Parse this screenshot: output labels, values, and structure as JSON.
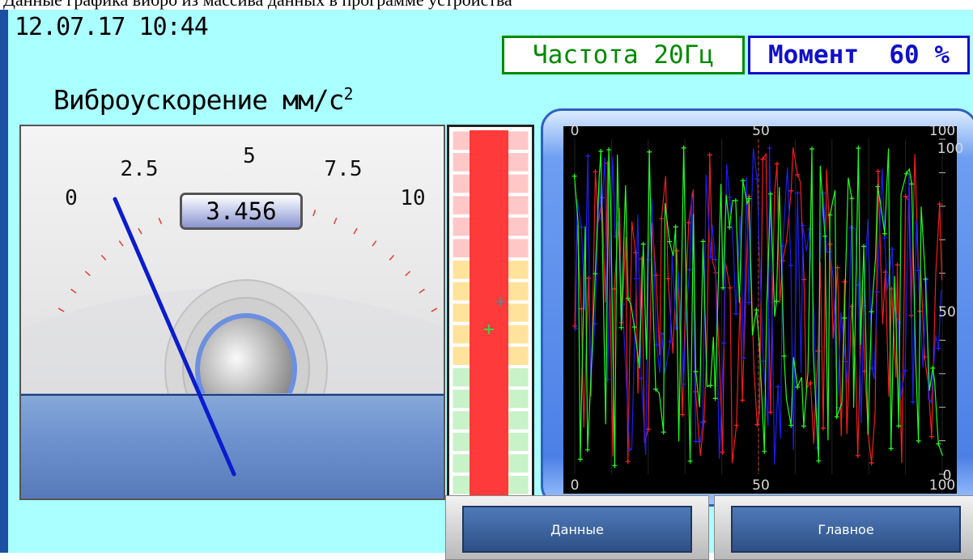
{
  "top_strip": {
    "text": "Данные графика вибро из массива данных в программе устройства"
  },
  "header": {
    "datetime": "12.07.17   10:44",
    "frequency": "Частота 20Гц",
    "moment_label": "Момент",
    "moment_value": "60 %"
  },
  "gauge": {
    "title": "Виброускорение мм/с",
    "title_sup": "2",
    "ticks": [
      "0",
      "2.5",
      "5",
      "7.5",
      "10"
    ],
    "readout": "3.456",
    "value": 3.456,
    "min": 0,
    "max": 10
  },
  "bargraph": {
    "level_percent": 100
  },
  "trend": {
    "x_axis_top": [
      "0",
      "50",
      "100"
    ],
    "x_axis_bottom": [
      "0",
      "50",
      "100"
    ],
    "y_axis_right": [
      "100",
      "50",
      "0"
    ],
    "series_colors": [
      "#ff2020",
      "#2020ff",
      "#20ff20"
    ]
  },
  "buttons": {
    "data_label": "Данные",
    "main_label": "Главное"
  },
  "colors": {
    "screen_bg": "#aaffff",
    "frequency": "#008a00",
    "moment": "#1010c8",
    "needle": "#0a1ccf",
    "bar_fill": "#ff3a3a"
  }
}
